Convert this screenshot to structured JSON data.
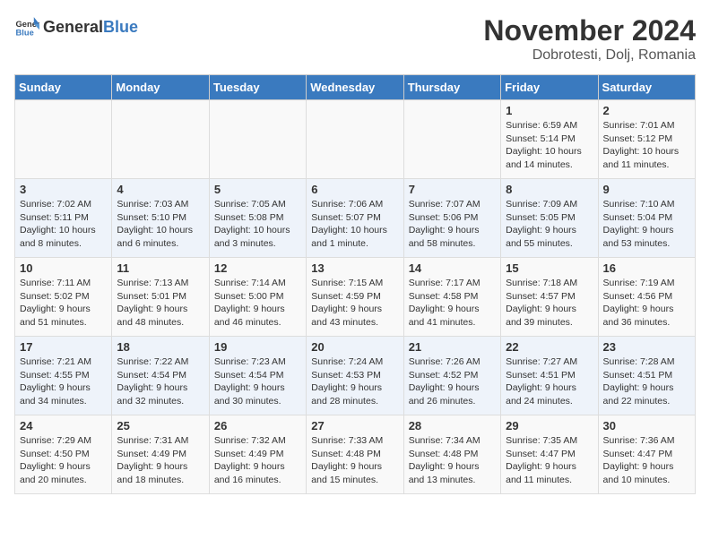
{
  "logo": {
    "general": "General",
    "blue": "Blue"
  },
  "title": "November 2024",
  "subtitle": "Dobrotesti, Dolj, Romania",
  "headers": [
    "Sunday",
    "Monday",
    "Tuesday",
    "Wednesday",
    "Thursday",
    "Friday",
    "Saturday"
  ],
  "weeks": [
    [
      {
        "day": "",
        "info": ""
      },
      {
        "day": "",
        "info": ""
      },
      {
        "day": "",
        "info": ""
      },
      {
        "day": "",
        "info": ""
      },
      {
        "day": "",
        "info": ""
      },
      {
        "day": "1",
        "info": "Sunrise: 6:59 AM\nSunset: 5:14 PM\nDaylight: 10 hours and 14 minutes."
      },
      {
        "day": "2",
        "info": "Sunrise: 7:01 AM\nSunset: 5:12 PM\nDaylight: 10 hours and 11 minutes."
      }
    ],
    [
      {
        "day": "3",
        "info": "Sunrise: 7:02 AM\nSunset: 5:11 PM\nDaylight: 10 hours and 8 minutes."
      },
      {
        "day": "4",
        "info": "Sunrise: 7:03 AM\nSunset: 5:10 PM\nDaylight: 10 hours and 6 minutes."
      },
      {
        "day": "5",
        "info": "Sunrise: 7:05 AM\nSunset: 5:08 PM\nDaylight: 10 hours and 3 minutes."
      },
      {
        "day": "6",
        "info": "Sunrise: 7:06 AM\nSunset: 5:07 PM\nDaylight: 10 hours and 1 minute."
      },
      {
        "day": "7",
        "info": "Sunrise: 7:07 AM\nSunset: 5:06 PM\nDaylight: 9 hours and 58 minutes."
      },
      {
        "day": "8",
        "info": "Sunrise: 7:09 AM\nSunset: 5:05 PM\nDaylight: 9 hours and 55 minutes."
      },
      {
        "day": "9",
        "info": "Sunrise: 7:10 AM\nSunset: 5:04 PM\nDaylight: 9 hours and 53 minutes."
      }
    ],
    [
      {
        "day": "10",
        "info": "Sunrise: 7:11 AM\nSunset: 5:02 PM\nDaylight: 9 hours and 51 minutes."
      },
      {
        "day": "11",
        "info": "Sunrise: 7:13 AM\nSunset: 5:01 PM\nDaylight: 9 hours and 48 minutes."
      },
      {
        "day": "12",
        "info": "Sunrise: 7:14 AM\nSunset: 5:00 PM\nDaylight: 9 hours and 46 minutes."
      },
      {
        "day": "13",
        "info": "Sunrise: 7:15 AM\nSunset: 4:59 PM\nDaylight: 9 hours and 43 minutes."
      },
      {
        "day": "14",
        "info": "Sunrise: 7:17 AM\nSunset: 4:58 PM\nDaylight: 9 hours and 41 minutes."
      },
      {
        "day": "15",
        "info": "Sunrise: 7:18 AM\nSunset: 4:57 PM\nDaylight: 9 hours and 39 minutes."
      },
      {
        "day": "16",
        "info": "Sunrise: 7:19 AM\nSunset: 4:56 PM\nDaylight: 9 hours and 36 minutes."
      }
    ],
    [
      {
        "day": "17",
        "info": "Sunrise: 7:21 AM\nSunset: 4:55 PM\nDaylight: 9 hours and 34 minutes."
      },
      {
        "day": "18",
        "info": "Sunrise: 7:22 AM\nSunset: 4:54 PM\nDaylight: 9 hours and 32 minutes."
      },
      {
        "day": "19",
        "info": "Sunrise: 7:23 AM\nSunset: 4:54 PM\nDaylight: 9 hours and 30 minutes."
      },
      {
        "day": "20",
        "info": "Sunrise: 7:24 AM\nSunset: 4:53 PM\nDaylight: 9 hours and 28 minutes."
      },
      {
        "day": "21",
        "info": "Sunrise: 7:26 AM\nSunset: 4:52 PM\nDaylight: 9 hours and 26 minutes."
      },
      {
        "day": "22",
        "info": "Sunrise: 7:27 AM\nSunset: 4:51 PM\nDaylight: 9 hours and 24 minutes."
      },
      {
        "day": "23",
        "info": "Sunrise: 7:28 AM\nSunset: 4:51 PM\nDaylight: 9 hours and 22 minutes."
      }
    ],
    [
      {
        "day": "24",
        "info": "Sunrise: 7:29 AM\nSunset: 4:50 PM\nDaylight: 9 hours and 20 minutes."
      },
      {
        "day": "25",
        "info": "Sunrise: 7:31 AM\nSunset: 4:49 PM\nDaylight: 9 hours and 18 minutes."
      },
      {
        "day": "26",
        "info": "Sunrise: 7:32 AM\nSunset: 4:49 PM\nDaylight: 9 hours and 16 minutes."
      },
      {
        "day": "27",
        "info": "Sunrise: 7:33 AM\nSunset: 4:48 PM\nDaylight: 9 hours and 15 minutes."
      },
      {
        "day": "28",
        "info": "Sunrise: 7:34 AM\nSunset: 4:48 PM\nDaylight: 9 hours and 13 minutes."
      },
      {
        "day": "29",
        "info": "Sunrise: 7:35 AM\nSunset: 4:47 PM\nDaylight: 9 hours and 11 minutes."
      },
      {
        "day": "30",
        "info": "Sunrise: 7:36 AM\nSunset: 4:47 PM\nDaylight: 9 hours and 10 minutes."
      }
    ]
  ]
}
